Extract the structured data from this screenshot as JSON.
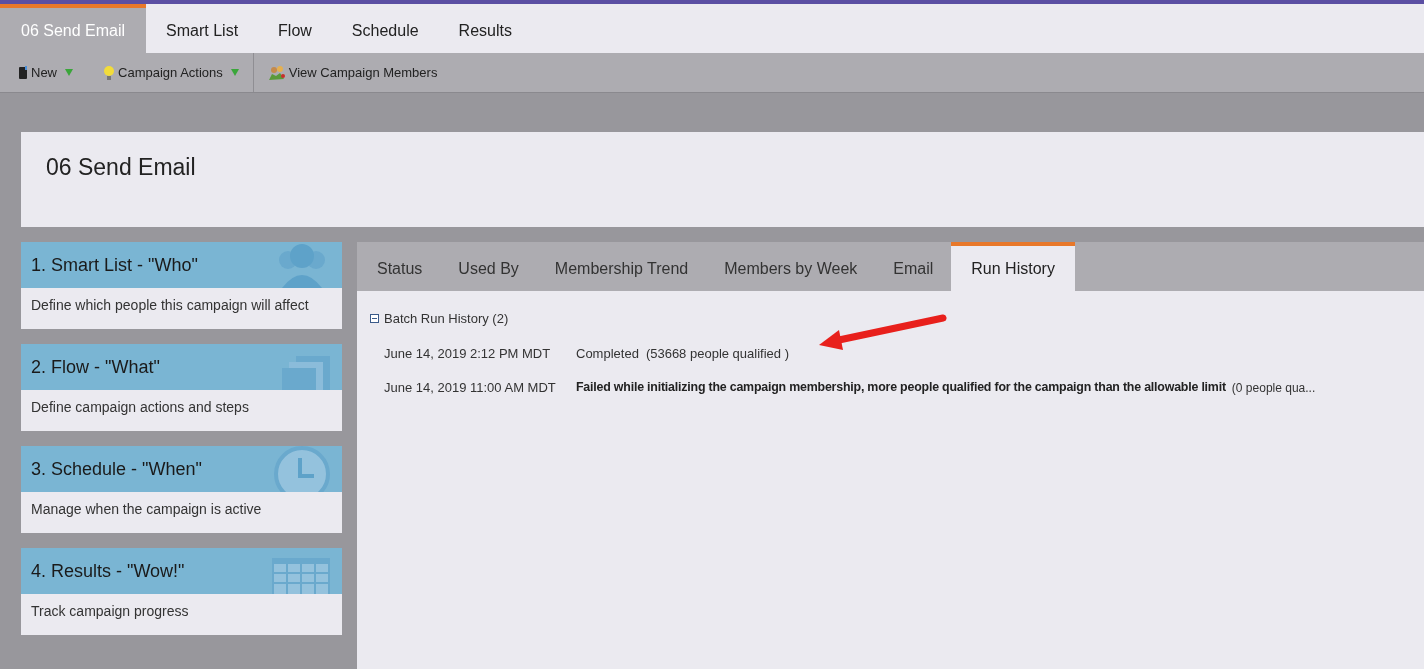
{
  "top_tabs": [
    {
      "label": "06 Send Email",
      "selected": true
    },
    {
      "label": "Smart List",
      "selected": false
    },
    {
      "label": "Flow",
      "selected": false
    },
    {
      "label": "Schedule",
      "selected": false
    },
    {
      "label": "Results",
      "selected": false
    }
  ],
  "toolbar": [
    {
      "label": "New",
      "kind": "new",
      "dropdown": true
    },
    {
      "label": "Campaign Actions",
      "kind": "actions",
      "dropdown": true
    },
    {
      "label": "View Campaign Members",
      "kind": "members",
      "dropdown": false
    }
  ],
  "title": "06 Send Email",
  "steps": [
    {
      "kind": "people",
      "title": "1. Smart List - \"Who\"",
      "description": "Define which people this campaign will affect"
    },
    {
      "kind": "flow",
      "title": "2. Flow - \"What\"",
      "description": "Define campaign actions and steps"
    },
    {
      "kind": "clock",
      "title": "3. Schedule - \"When\"",
      "description": "Manage when the campaign is active"
    },
    {
      "kind": "table",
      "title": "4. Results - \"Wow!\"",
      "description": "Track campaign progress"
    }
  ],
  "detail_tabs": [
    {
      "label": "Status",
      "selected": false
    },
    {
      "label": "Used By",
      "selected": false
    },
    {
      "label": "Membership Trend",
      "selected": false
    },
    {
      "label": "Members by Week",
      "selected": false
    },
    {
      "label": "Email",
      "selected": false
    },
    {
      "label": "Run History",
      "selected": true
    }
  ],
  "run_history": {
    "title": "Batch Run History (2)",
    "expanded": true,
    "rows": [
      {
        "time": "June 14, 2019 2:12 PM MDT",
        "status": "Completed",
        "failed": false,
        "detail": "(53668 people qualified )"
      },
      {
        "time": "June 14, 2019 11:00 AM MDT",
        "status": "Failed while initializing the campaign membership, more people qualified for the campaign than the allowable limit",
        "failed": true,
        "detail": "(0 people qua..."
      }
    ]
  }
}
